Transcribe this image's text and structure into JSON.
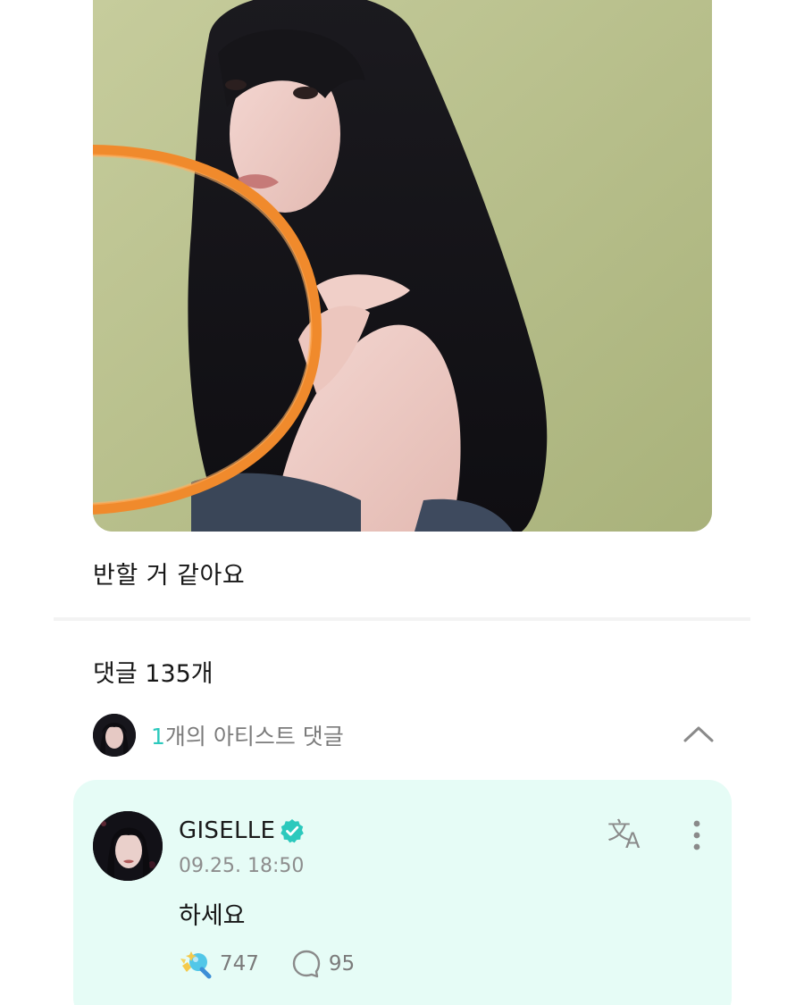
{
  "post": {
    "image_icon": "photo-image",
    "text": "반할 거 같아요"
  },
  "comments": {
    "header": "댓글 135개"
  },
  "artist_comments": {
    "count": "1",
    "label": "개의 아티스트 댓글",
    "toggle_icon": "chevron-up-icon"
  },
  "artist_comment": {
    "author": "GISELLE",
    "verified_icon": "verified-badge-icon",
    "timestamp": "09.25. 18:50",
    "body": "하세요",
    "likes": "747",
    "replies": "95",
    "accent_color": "#2cc9bd",
    "card_color": "#e6fcf6"
  }
}
